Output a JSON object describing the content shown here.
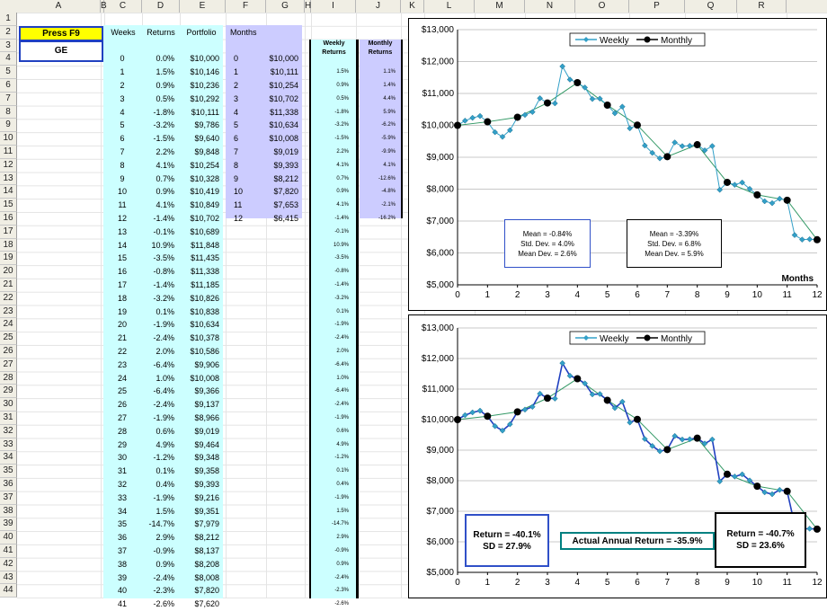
{
  "sheet": {
    "columns": [
      "A",
      "B",
      "C",
      "D",
      "E",
      "F",
      "G",
      "H",
      "I",
      "J",
      "K",
      "L",
      "M",
      "N",
      "O",
      "P",
      "Q",
      "R"
    ],
    "rows": [
      "1",
      "2",
      "3",
      "4",
      "5",
      "6",
      "7",
      "8",
      "9",
      "10",
      "11",
      "12",
      "13",
      "14",
      "15",
      "16",
      "17",
      "18",
      "19",
      "20",
      "21",
      "22",
      "23",
      "24",
      "25",
      "26",
      "27",
      "28",
      "29",
      "30",
      "31",
      "32",
      "33",
      "34",
      "35",
      "36",
      "37",
      "38",
      "39",
      "40",
      "41",
      "42",
      "43",
      "44"
    ],
    "press_label": "Press F9",
    "ticker": "GE",
    "headers": {
      "weeks": "Weeks",
      "returns": "Returns",
      "portfolio": "Portfolio",
      "months": "Months",
      "weekly_returns": "Weekly Returns",
      "monthly_returns": "Monthly Returns"
    },
    "weeks": [
      "0",
      "1",
      "2",
      "3",
      "4",
      "5",
      "6",
      "7",
      "8",
      "9",
      "10",
      "11",
      "12",
      "13",
      "14",
      "15",
      "16",
      "17",
      "18",
      "19",
      "20",
      "21",
      "22",
      "23",
      "24",
      "25",
      "26",
      "27",
      "28",
      "29",
      "30",
      "31",
      "32",
      "33",
      "34",
      "35",
      "36",
      "37",
      "38",
      "39",
      "40",
      "41"
    ],
    "returns": [
      "0.0%",
      "1.5%",
      "0.9%",
      "0.5%",
      "-1.8%",
      "-3.2%",
      "-1.5%",
      "2.2%",
      "4.1%",
      "0.7%",
      "0.9%",
      "4.1%",
      "-1.4%",
      "-0.1%",
      "10.9%",
      "-3.5%",
      "-0.8%",
      "-1.4%",
      "-3.2%",
      "0.1%",
      "-1.9%",
      "-2.4%",
      "2.0%",
      "-6.4%",
      "1.0%",
      "-6.4%",
      "-2.4%",
      "-1.9%",
      "0.6%",
      "4.9%",
      "-1.2%",
      "0.1%",
      "0.4%",
      "-1.9%",
      "1.5%",
      "-14.7%",
      "2.9%",
      "-0.9%",
      "0.9%",
      "-2.4%",
      "-2.3%",
      "-2.6%"
    ],
    "portfolio": [
      "$10,000",
      "$10,146",
      "$10,236",
      "$10,292",
      "$10,111",
      "$9,786",
      "$9,640",
      "$9,848",
      "$10,254",
      "$10,328",
      "$10,419",
      "$10,849",
      "$10,702",
      "$10,689",
      "$11,848",
      "$11,435",
      "$11,338",
      "$11,185",
      "$10,826",
      "$10,838",
      "$10,634",
      "$10,378",
      "$10,586",
      "$9,906",
      "$10,008",
      "$9,366",
      "$9,137",
      "$8,966",
      "$9,019",
      "$9,464",
      "$9,348",
      "$9,358",
      "$9,393",
      "$9,216",
      "$9,351",
      "$7,979",
      "$8,212",
      "$8,137",
      "$8,208",
      "$8,008",
      "$7,820",
      "$7,620"
    ],
    "months": [
      "0",
      "1",
      "2",
      "3",
      "4",
      "5",
      "6",
      "7",
      "8",
      "9",
      "10",
      "11",
      "12"
    ],
    "month_values": [
      "$10,000",
      "$10,111",
      "$10,254",
      "$10,702",
      "$11,338",
      "$10,634",
      "$10,008",
      "$9,019",
      "$9,393",
      "$8,212",
      "$7,820",
      "$7,653",
      "$6,415"
    ],
    "weekly_returns_col": [
      "1.5%",
      "0.9%",
      "0.5%",
      "-1.8%",
      "-3.2%",
      "-1.5%",
      "2.2%",
      "4.1%",
      "0.7%",
      "0.9%",
      "4.1%",
      "-1.4%",
      "-0.1%",
      "10.9%",
      "-3.5%",
      "-0.8%",
      "-1.4%",
      "-3.2%",
      "0.1%",
      "-1.9%",
      "-2.4%",
      "2.0%",
      "-6.4%",
      "1.0%",
      "-6.4%",
      "-2.4%",
      "-1.9%",
      "0.6%",
      "4.9%",
      "-1.2%",
      "0.1%",
      "0.4%",
      "-1.9%",
      "1.5%",
      "-14.7%",
      "2.9%",
      "-0.9%",
      "0.9%",
      "-2.4%",
      "-2.3%",
      "-2.6%"
    ],
    "monthly_returns_col": [
      "1.1%",
      "1.4%",
      "4.4%",
      "5.9%",
      "-6.2%",
      "-5.9%",
      "-9.9%",
      "4.1%",
      "-12.6%",
      "-4.8%",
      "-2.1%",
      "-16.2%"
    ]
  },
  "colors": {
    "yellow": "#ffff00",
    "cyan": "#ccffff",
    "lavender": "#ccccff",
    "weekly": "#33a0c8",
    "monthly": "#000000",
    "trend": "#339966",
    "box_blue": "#3050c8",
    "box_green": "#008080"
  },
  "chart_data": [
    {
      "type": "line",
      "title": "",
      "xlabel": "Months",
      "ylabel": "",
      "xlim": [
        0,
        12
      ],
      "ylim": [
        5000,
        13000
      ],
      "xticks": [
        "0",
        "1",
        "2",
        "3",
        "4",
        "5",
        "6",
        "7",
        "8",
        "9",
        "10",
        "11",
        "12"
      ],
      "yticks": [
        "$5,000",
        "$6,000",
        "$7,000",
        "$8,000",
        "$9,000",
        "$10,000",
        "$11,000",
        "$12,000",
        "$13,000"
      ],
      "legend": "top-center",
      "series": [
        {
          "name": "Weekly",
          "x": [
            0,
            0.25,
            0.5,
            0.75,
            1,
            1.25,
            1.5,
            1.75,
            2,
            2.25,
            2.5,
            2.75,
            3,
            3.25,
            3.5,
            3.75,
            4,
            4.25,
            4.5,
            4.75,
            5,
            5.25,
            5.5,
            5.75,
            6,
            6.25,
            6.5,
            6.75,
            7,
            7.25,
            7.5,
            7.75,
            8,
            8.25,
            8.5,
            8.75,
            9,
            9.25,
            9.5,
            9.75,
            10,
            10.25,
            10.5,
            10.75,
            11,
            11.25,
            11.5,
            11.75,
            12
          ],
          "y": [
            10000,
            10146,
            10236,
            10292,
            10111,
            9786,
            9640,
            9848,
            10254,
            10328,
            10419,
            10849,
            10702,
            10689,
            11848,
            11435,
            11338,
            11185,
            10826,
            10838,
            10634,
            10378,
            10586,
            9906,
            10008,
            9366,
            9137,
            8966,
            9019,
            9464,
            9348,
            9358,
            9393,
            9216,
            9351,
            7979,
            8212,
            8137,
            8208,
            8008,
            7820,
            7620,
            7560,
            7700,
            7653,
            6560,
            6420,
            6430,
            6415
          ]
        },
        {
          "name": "Monthly",
          "x": [
            0,
            1,
            2,
            3,
            4,
            5,
            6,
            7,
            8,
            9,
            10,
            11,
            12
          ],
          "y": [
            10000,
            10111,
            10254,
            10702,
            11338,
            10634,
            10008,
            9019,
            9393,
            8212,
            7820,
            7653,
            6415
          ]
        }
      ],
      "annotations": [
        {
          "lines": [
            "Mean = -0.84%",
            "Std. Dev. = 4.0%",
            "Mean Dev. = 2.6%"
          ],
          "border": "#3050c8"
        },
        {
          "lines": [
            "Mean = -3.39%",
            "Std. Dev. = 6.8%",
            "Mean Dev. = 5.9%"
          ],
          "border": "#000000"
        }
      ]
    },
    {
      "type": "line",
      "title": "",
      "xlabel": "",
      "ylabel": "",
      "xlim": [
        0,
        12
      ],
      "ylim": [
        5000,
        13000
      ],
      "xticks": [
        "0",
        "1",
        "2",
        "3",
        "4",
        "5",
        "6",
        "7",
        "8",
        "9",
        "10",
        "11",
        "12"
      ],
      "yticks": [
        "$5,000",
        "$6,000",
        "$7,000",
        "$8,000",
        "$9,000",
        "$10,000",
        "$11,000",
        "$12,000",
        "$13,000"
      ],
      "legend": "top-center",
      "series": [
        {
          "name": "Weekly",
          "x": [
            0,
            0.25,
            0.5,
            0.75,
            1,
            1.25,
            1.5,
            1.75,
            2,
            2.25,
            2.5,
            2.75,
            3,
            3.25,
            3.5,
            3.75,
            4,
            4.25,
            4.5,
            4.75,
            5,
            5.25,
            5.5,
            5.75,
            6,
            6.25,
            6.5,
            6.75,
            7,
            7.25,
            7.5,
            7.75,
            8,
            8.25,
            8.5,
            8.75,
            9,
            9.25,
            9.5,
            9.75,
            10,
            10.25,
            10.5,
            10.75,
            11,
            11.25,
            11.5,
            11.75,
            12
          ],
          "y": [
            10000,
            10146,
            10236,
            10292,
            10111,
            9786,
            9640,
            9848,
            10254,
            10328,
            10419,
            10849,
            10702,
            10689,
            11848,
            11435,
            11338,
            11185,
            10826,
            10838,
            10634,
            10378,
            10586,
            9906,
            10008,
            9366,
            9137,
            8966,
            9019,
            9464,
            9348,
            9358,
            9393,
            9216,
            9351,
            7979,
            8212,
            8137,
            8208,
            8008,
            7820,
            7620,
            7560,
            7700,
            7653,
            6560,
            6420,
            6430,
            6415
          ]
        },
        {
          "name": "Monthly",
          "x": [
            0,
            1,
            2,
            3,
            4,
            5,
            6,
            7,
            8,
            9,
            10,
            11,
            12
          ],
          "y": [
            10000,
            10111,
            10254,
            10702,
            11338,
            10634,
            10008,
            9019,
            9393,
            8212,
            7820,
            7653,
            6415
          ]
        }
      ],
      "annotations": [
        {
          "lines": [
            "Return = -40.1%",
            "SD = 27.9%"
          ],
          "border": "#3050c8"
        },
        {
          "lines": [
            "Actual Annual Return = -35.9%"
          ],
          "border": "#008080"
        },
        {
          "lines": [
            "Return = -40.7%",
            "SD = 23.6%"
          ],
          "border": "#000000"
        }
      ]
    }
  ]
}
